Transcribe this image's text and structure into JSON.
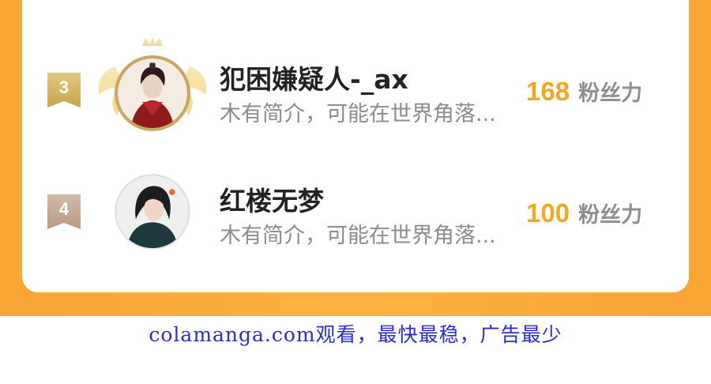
{
  "leaderboard": {
    "entries": [
      {
        "rank": "3",
        "name": "犯困嫌疑人-_ax",
        "description": "木有简介，可能在世界角落...",
        "fans_value": "168",
        "fans_label": "粉丝力",
        "badge_color": "#d4b86a",
        "has_wings": true
      },
      {
        "rank": "4",
        "name": "红楼无梦",
        "description": "木有简介，可能在世界角落...",
        "fans_value": "100",
        "fans_label": "粉丝力",
        "badge_color": "#c6ab97",
        "has_wings": false
      }
    ]
  },
  "watermark": {
    "text": "colamanga.com观看，最快最稳，广告最少"
  },
  "colors": {
    "background_orange": "#fbb242",
    "accent_fans": "#f5a623",
    "name_text": "#222222",
    "desc_text": "#8c8c8c",
    "watermark_text": "#2b2bd6"
  }
}
